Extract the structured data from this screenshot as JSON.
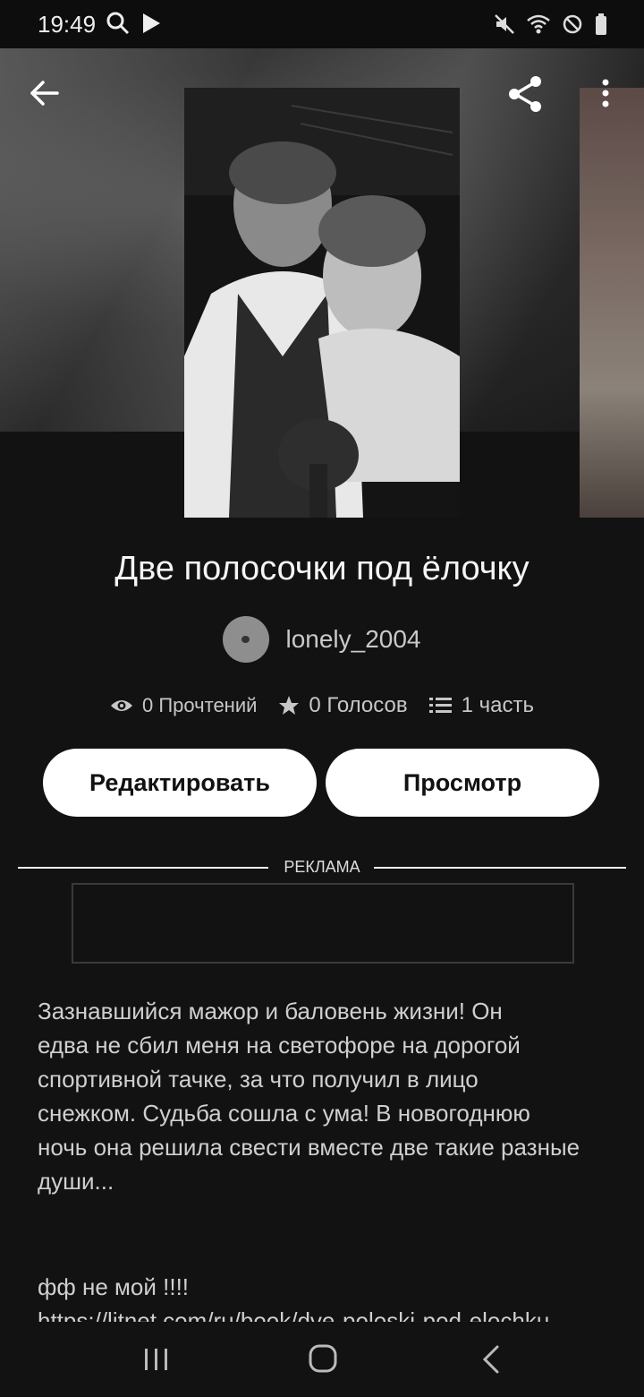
{
  "status_bar": {
    "time": "19:49",
    "left_icons": [
      "search-icon",
      "play-icon"
    ],
    "right_icons": [
      "mute-icon",
      "wifi-icon",
      "do-not-disturb-icon",
      "battery-icon"
    ]
  },
  "header": {
    "back_icon": "arrow-left-icon",
    "share_icon": "share-icon",
    "more_icon": "more-vertical-icon"
  },
  "story": {
    "title": "Две полосочки под ёлочку",
    "author": "lonely_2004",
    "stats": {
      "reads": "0 Прочтений",
      "votes": "0 Голосов",
      "parts": "1 часть"
    }
  },
  "actions": {
    "edit_label": "Редактировать",
    "preview_label": "Просмотр"
  },
  "ad": {
    "label": "РЕКЛАМА"
  },
  "description": {
    "text": "Зазнавшийся мажор и баловень жизни! Он\nедва не сбил меня на светофоре на дорогой\nспортивной тачке, за что получил в лицо\nснежком. Судьба сошла с ума! В новогоднюю\nночь она решила свести вместе две такие разные\nдуши...",
    "note": "фф не мой !!!!",
    "link": "https://litnet.com/ru/book/dve-poloski-pod-elochku"
  },
  "colors": {
    "background": "#121212",
    "button_bg": "#ffffff",
    "button_text": "#111111"
  }
}
